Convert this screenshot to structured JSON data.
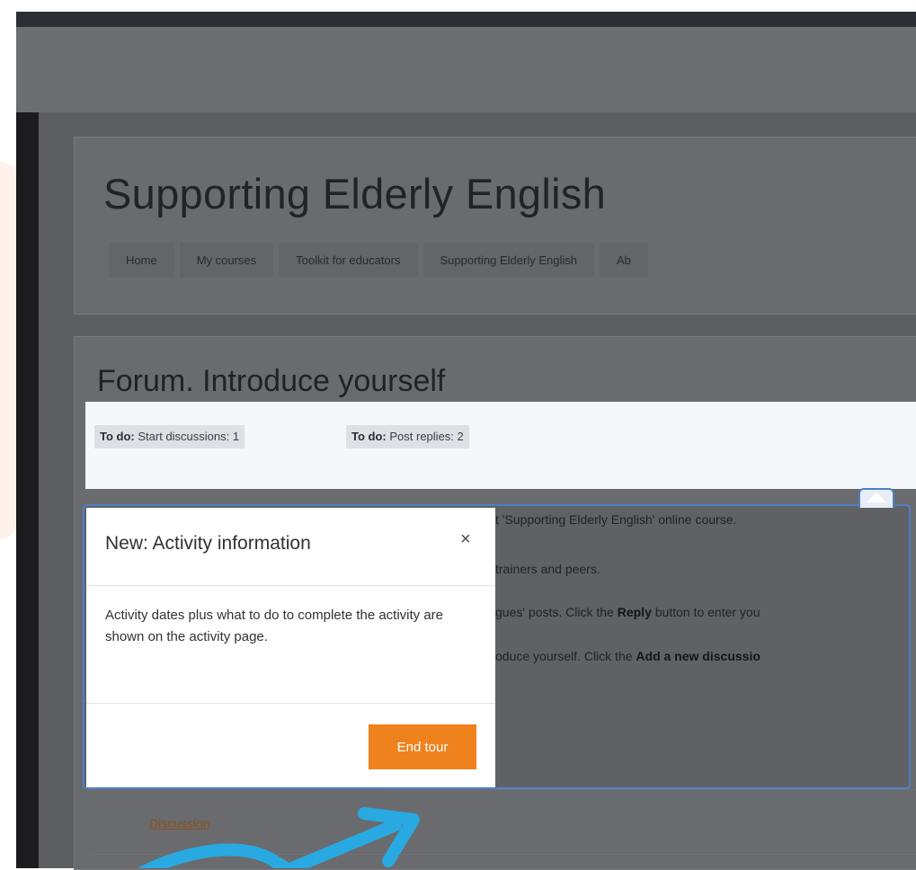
{
  "header": {
    "site_title": "Supporting Elderly English",
    "breadcrumbs": [
      "Home",
      "My courses",
      "Toolkit for educators",
      "Supporting Elderly English",
      "Ab"
    ]
  },
  "page": {
    "title": "Forum. Introduce yourself",
    "todos": [
      {
        "label": "To do:",
        "text": "Start discussions: 1"
      },
      {
        "label": "To do:",
        "text": "Post replies: 2"
      }
    ],
    "intro_lines": [
      {
        "text": "t 'Supporting Elderly English' online course."
      },
      {
        "text": "trainers and peers."
      },
      {
        "before": "gues' posts. Click the ",
        "bold": "Reply",
        "after": " button to enter you"
      },
      {
        "before": "oduce yourself. Click the ",
        "bold": "Add a new discussio",
        "after": ""
      }
    ],
    "discussion_link": "Discussion"
  },
  "tour": {
    "title": "New: Activity information",
    "close": "×",
    "body": "Activity dates plus what to do to complete the activity are shown on the activity page.",
    "end_button": "End tour"
  },
  "colors": {
    "accent_orange": "#f0821e",
    "highlight_blue": "#4f7fc6",
    "annotation_arrow": "#29a9e1"
  }
}
